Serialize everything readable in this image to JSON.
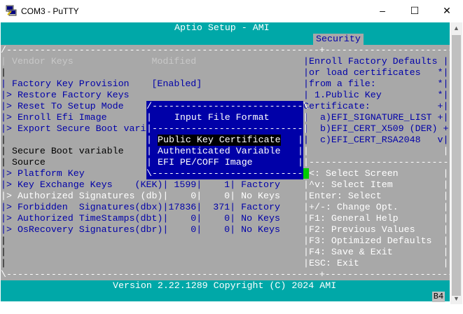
{
  "window": {
    "title": "COM3 - PuTTY",
    "minimize": "–",
    "maximize": "☐",
    "close": "✕"
  },
  "bios": {
    "header": "Aptio Setup - AMI",
    "active_tab": "Security",
    "left_lines": [
      "| Vendor Keys              Modified",
      "|",
      "| Factory Key Provision    [Enabled]",
      "|> Restore Factory Keys",
      "|> Reset To Setup Mode",
      "|> Enroll Efi Image",
      "|> Export Secure Boot vari",
      "|",
      "| Secure Boot variable",
      "| Source",
      "|> Platform Key           (",
      "|> Key Exchange Keys    (KEK)| 1599|    1| Factory",
      "|> Authorized Signatures (db)|    0|    0| No Keys",
      "|> Forbidden  Signatures(dbx)|17836|  371| Factory",
      "|> Authorized TimeStamps(dbt)|    0|    0| No Keys",
      "|> OsRecovery Signatures(dbr)|    0|    0| No Keys",
      "|",
      "|",
      "|"
    ],
    "right_lines": [
      "|Enroll Factory Defaults |",
      "|or load certificates   *|",
      "|from a file:           *|",
      "| 1.Public Key          *|",
      "Certificate:            +|",
      "|  a)EFI_SIGNATURE_LIST +|",
      "|  b)EFI_CERT_X509 (DER) +|",
      "|  c)EFI_CERT_RSA2048   v|",
      "|                        |",
      "|-------------------------",
      "><: Select Screen        |",
      "|^v: Select Item         |",
      "|Enter: Select           |",
      "|+/-: Change Opt.        |",
      "|F1: General Help        |",
      "|F2: Previous Values     |",
      "|F3: Optimized Defaults  |",
      "|F4: Save & Exit         |",
      "|ESC: Exit               |"
    ],
    "top_border": "/--------------------------------------------------------+-------------------------\\",
    "bottom_border": "\\--------------------------------------------------------+-------------------------/",
    "footer": "Version 2.22.1289 Copyright (C) 2024 AMI",
    "status_code": "B4"
  },
  "dialog": {
    "top": "/---------------------------\\",
    "title": "|    Input File Format      |",
    "separator": "|---------------------------|",
    "options": [
      "Public Key Certificate",
      "Authenticated Variable",
      "EFI PE/COFF Image"
    ],
    "selected_index": 0,
    "bottom": "\\---------------------------/"
  }
}
